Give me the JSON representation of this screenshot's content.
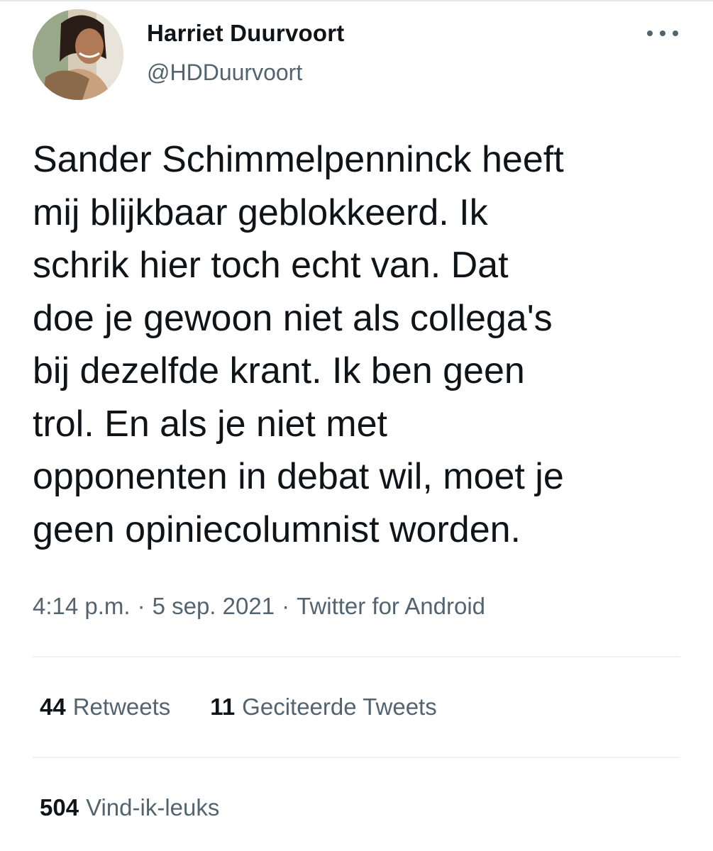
{
  "author": {
    "name": "Harriet Duurvoort",
    "handle": "@HDDuurvoort"
  },
  "icons": {
    "more": "more-horizontal-icon"
  },
  "tweet": {
    "lines": [
      "Sander Schimmelpenninck heeft",
      "mij blijkbaar geblokkeerd. Ik",
      "schrik hier toch echt van. Dat",
      "doe je gewoon niet als collega's",
      "bij dezelfde krant. Ik ben geen",
      "trol. En als je niet met",
      "opponenten in debat wil, moet je",
      "geen opiniecolumnist worden."
    ]
  },
  "meta": {
    "time": "4:14 p.m.",
    "separator": "·",
    "date": "5 sep. 2021",
    "source": "Twitter for Android"
  },
  "stats": {
    "retweets": {
      "count": "44",
      "label": "Retweets"
    },
    "quotes": {
      "count": "11",
      "label": "Geciteerde Tweets"
    },
    "likes": {
      "count": "504",
      "label": "Vind-ik-leuks"
    }
  },
  "colors": {
    "text": "#0f1419",
    "secondary": "#536471",
    "divider": "#eff3f4"
  }
}
